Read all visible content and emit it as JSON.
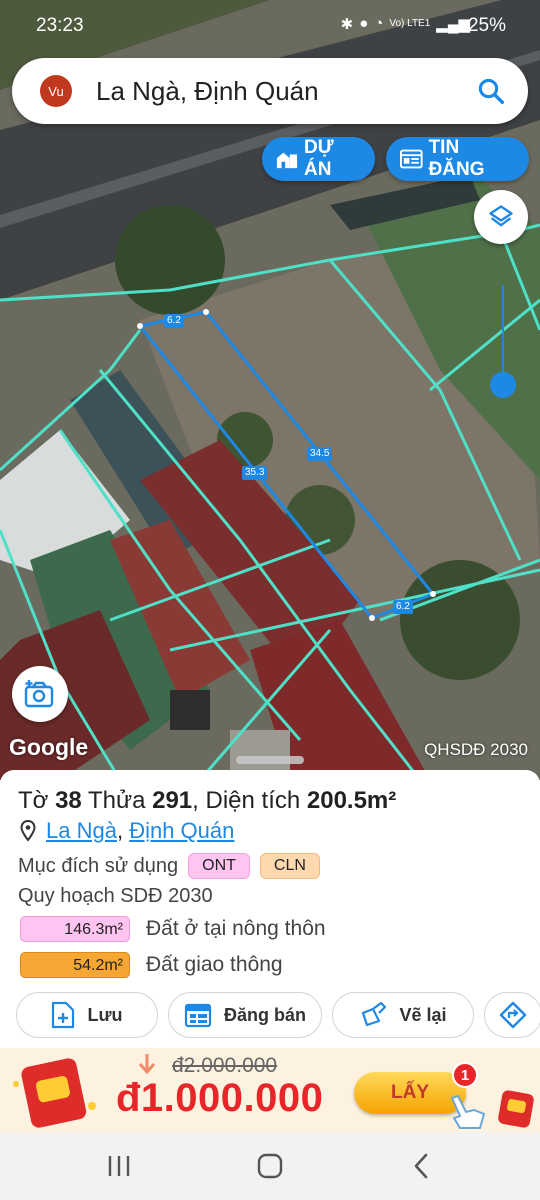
{
  "status_bar": {
    "time": "23:23",
    "network": "Vo) LTE1",
    "battery": "25%"
  },
  "search": {
    "avatar_text": "Vu",
    "query": "La Ngà, Định Quán"
  },
  "chips": {
    "project_label": "DỰ ÁN",
    "listing_label": "TIN ĐĂNG"
  },
  "map": {
    "attribution": "Google",
    "layer_label": "QHSDĐ 2030",
    "dimensions": [
      "6.2",
      "34.5",
      "35.3",
      "6.2"
    ],
    "parcel_color": "#1e88e5",
    "boundary_color": "#4fe0c8"
  },
  "parcel": {
    "sheet_label": "Tờ",
    "sheet_number": "38",
    "plot_label": "Thửa",
    "plot_number": "291",
    "area_label": ", Diện tích",
    "area_value": "200.5m²",
    "location_commune": "La Ngà",
    "location_separator": ",",
    "location_district": "Định Quán",
    "usage_label": "Mục đích sử dụng",
    "usage_codes": [
      "ONT",
      "CLN"
    ],
    "plan_title": "Quy hoạch SDĐ 2030",
    "plan_items": [
      {
        "area": "146.3m²",
        "label": "Đất ở tại nông thôn",
        "color": "#ffc4f0"
      },
      {
        "area": "54.2m²",
        "label": "Đất giao thông",
        "color": "#f5a633"
      }
    ]
  },
  "actions": {
    "save_label": "Lưu",
    "sell_label": "Đăng bán",
    "redraw_label": "Vẽ lại"
  },
  "promo": {
    "old_price": "đ2.000.000",
    "new_price": "đ1.000.000",
    "get_label": "LẤY",
    "badge_count": "1"
  }
}
